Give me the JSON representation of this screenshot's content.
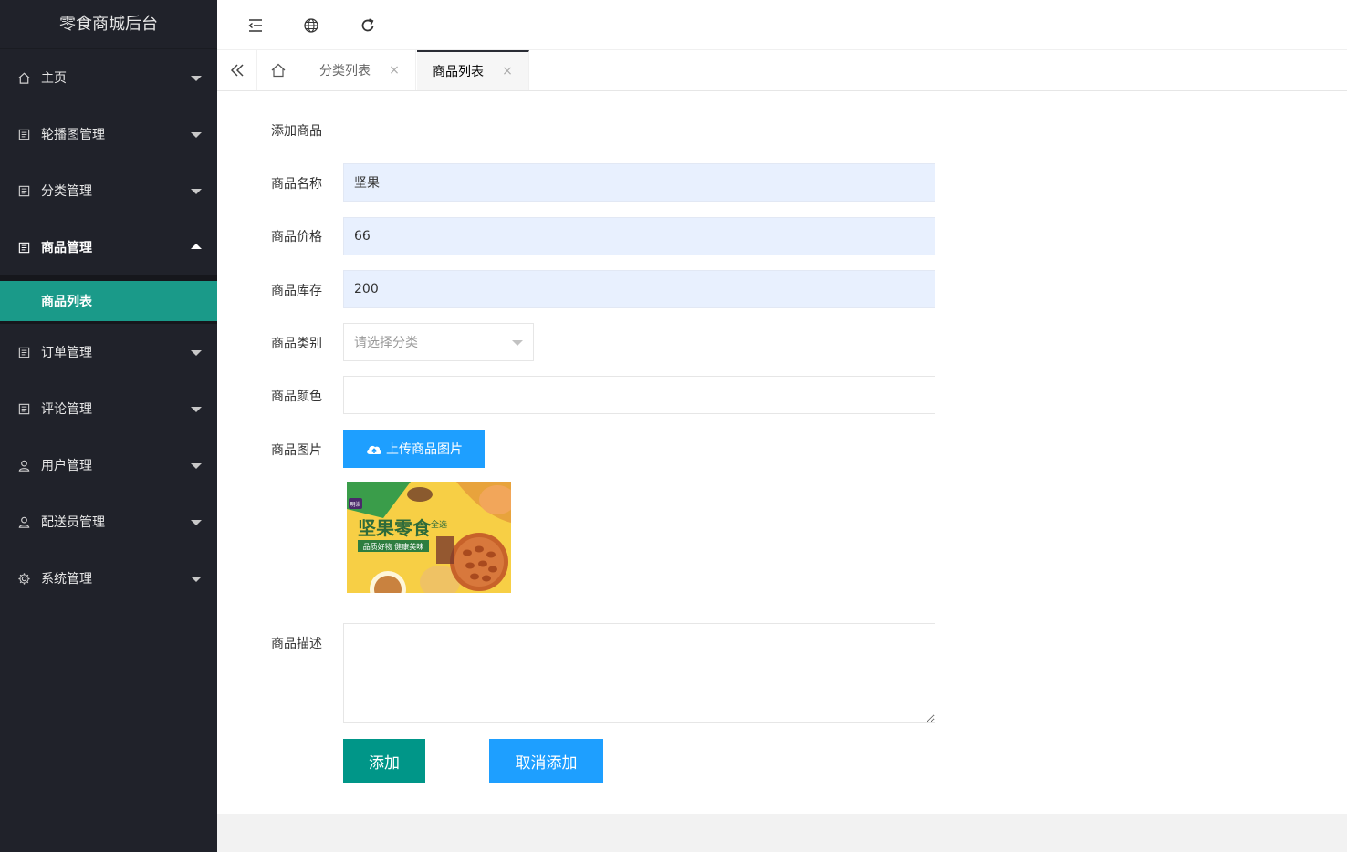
{
  "app": {
    "title": "零食商城后台"
  },
  "colors": {
    "sidebar_bg": "#20222a",
    "accent_green": "#009688",
    "accent_blue": "#1e9fff",
    "active_sub_bg": "#1a9a89"
  },
  "sidebar": {
    "items": [
      {
        "label": "主页",
        "icon": "home-icon",
        "expanded": false
      },
      {
        "label": "轮播图管理",
        "icon": "file-icon",
        "expanded": false
      },
      {
        "label": "分类管理",
        "icon": "file-icon",
        "expanded": false
      },
      {
        "label": "商品管理",
        "icon": "file-icon",
        "expanded": true
      },
      {
        "label": "订单管理",
        "icon": "file-icon",
        "expanded": false
      },
      {
        "label": "评论管理",
        "icon": "file-icon",
        "expanded": false
      },
      {
        "label": "用户管理",
        "icon": "user-icon",
        "expanded": false
      },
      {
        "label": "配送员管理",
        "icon": "user-icon",
        "expanded": false
      },
      {
        "label": "系统管理",
        "icon": "gear-icon",
        "expanded": false
      }
    ],
    "active_sub": {
      "label": "商品列表"
    }
  },
  "header": {
    "icons": [
      "shrink-menu-icon",
      "globe-icon",
      "refresh-icon"
    ]
  },
  "tabs": {
    "items": [
      {
        "label": "分类列表",
        "active": false
      },
      {
        "label": "商品列表",
        "active": true
      }
    ],
    "close_symbol": "×"
  },
  "form": {
    "title": "添加商品",
    "name": {
      "label": "商品名称",
      "value": "坚果"
    },
    "price": {
      "label": "商品价格",
      "value": "66"
    },
    "stock": {
      "label": "商品库存",
      "value": "200"
    },
    "category": {
      "label": "商品类别",
      "placeholder": "请选择分类"
    },
    "color": {
      "label": "商品颜色",
      "value": ""
    },
    "image": {
      "label": "商品图片",
      "upload_label": "上传商品图片",
      "preview_brand": "明治",
      "preview_title": "坚果零食",
      "preview_side": "全选",
      "preview_slogan": "品质好物 健康美味"
    },
    "description": {
      "label": "商品描述",
      "value": ""
    },
    "submit_label": "添加",
    "cancel_label": "取消添加"
  }
}
